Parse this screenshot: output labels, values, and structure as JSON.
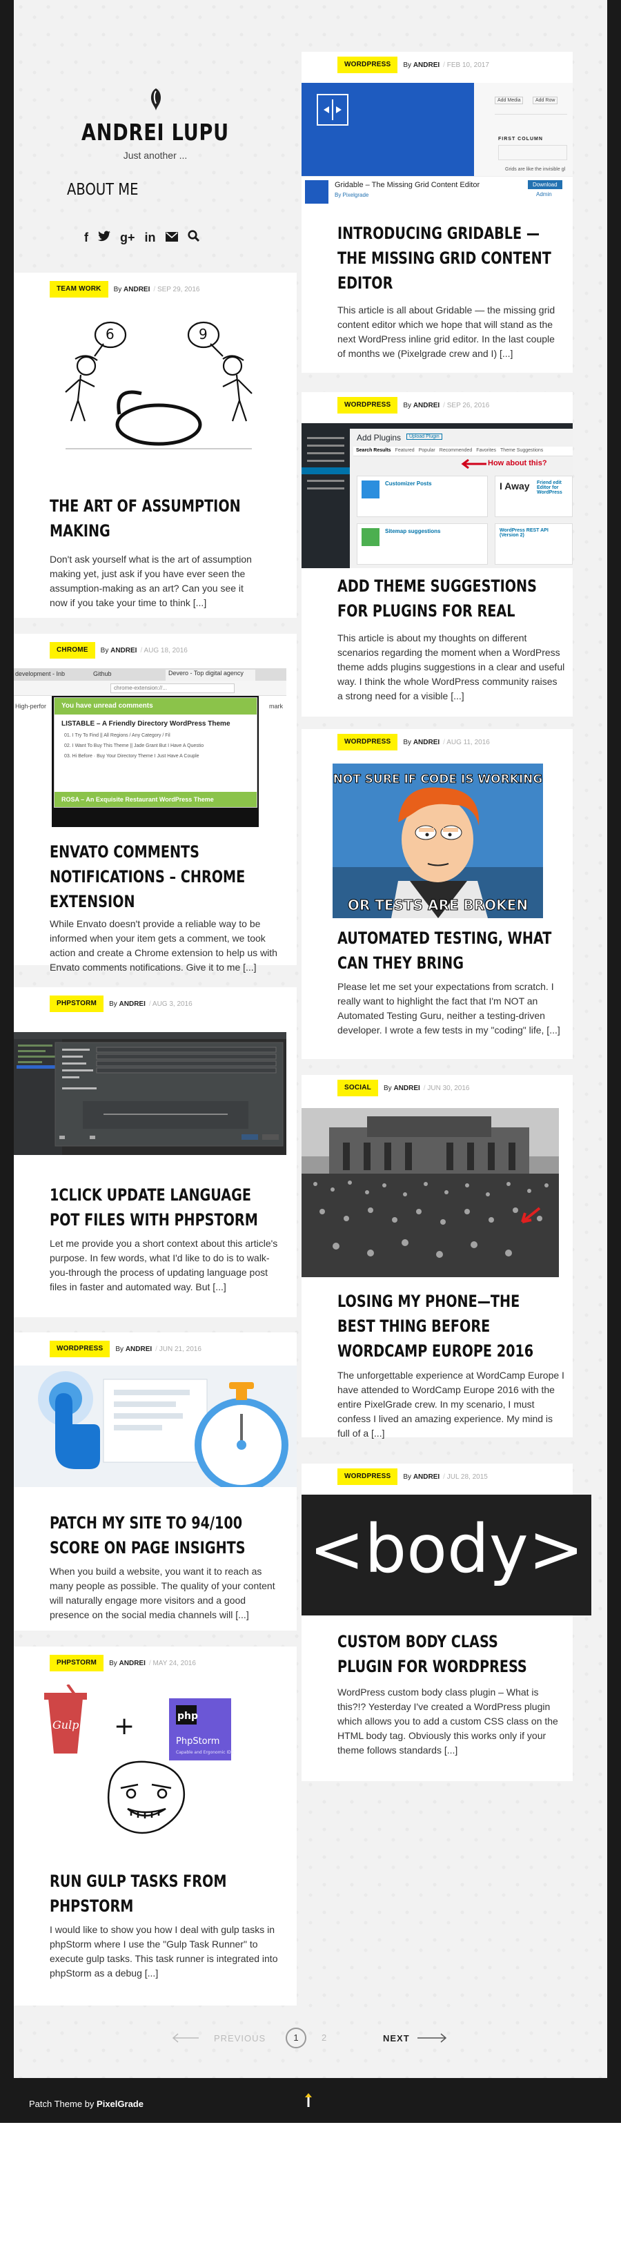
{
  "site": {
    "title": "ANDREI LUPU",
    "tagline": "Just another ...",
    "nav_about": "ABOUT ME",
    "social_icons": [
      "facebook-icon",
      "twitter-icon",
      "google-plus-icon",
      "linkedin-icon",
      "email-icon",
      "search-icon"
    ]
  },
  "colors": {
    "category_badge": "#fff200",
    "page_bg": "#f2f2f2",
    "frame_bg": "#1a1a1a",
    "card_bg": "#ffffff"
  },
  "posts": [
    {
      "category": "TEAM WORK",
      "by": "By",
      "author": "ANDREI",
      "date": "SEP 29, 2016",
      "title": "THE ART OF ASSUMPTION MAKING",
      "excerpt": "Don't ask yourself what is the art of assumption making yet, just ask if you have ever seen the assumption-making as an art? Can you see it now if you take your time to think [...]"
    },
    {
      "category": "CHROME",
      "by": "By",
      "author": "ANDREI",
      "date": "AUG 18, 2016",
      "title": "ENVATO COMMENTS NOTIFICATIONS – CHROME EXTENSION",
      "excerpt": "While Envato doesn't provide a reliable way to be informed when your item gets a comment, we took action and create a Chrome extension to help us with Envato comments notifications. Give it to me [...]",
      "thumb": {
        "tab1": "development - Inb",
        "tab2": "Github",
        "tab3": "Devero - Top digital agency",
        "url_bar": "chrome-extension://...",
        "popup_header": "You have unread comments",
        "popup_item1_title": "LISTABLE – A Friendly Directory WordPress Theme",
        "popup_item1_lines": [
          "01. I Try To Find || All Regions / Any Category / Fil",
          "02. I Want To Buy This Theme || Jade Grant But I Have A Questio",
          "03. Hi Before · Buy Your Directory Theme I Just Have A Couple"
        ],
        "popup_item2_title": "ROSA – An Exquisite Restaurant WordPress Theme",
        "left_text": "High-perfor",
        "right_text": "mark"
      }
    },
    {
      "category": "PHPSTORM",
      "by": "By",
      "author": "ANDREI",
      "date": "AUG 3, 2016",
      "title": "1CLICK UPDATE LANGUAGE POT FILES WITH PHPSTORM",
      "excerpt": "Let me provide you a short context about this article's purpose. In few words, what I'd like to do is to walk-you-through the process of updating language post files in faster and automated way. But [...]"
    },
    {
      "category": "WORDPRESS",
      "by": "By",
      "author": "ANDREI",
      "date": "JUN 21, 2016",
      "title": "PATCH MY SITE TO 94/100 SCORE ON PAGE INSIGHTS",
      "excerpt": "When you build a website, you want it to reach as many people as possible. The quality of your content will naturally engage more visitors and a good presence on the social media channels will [...]"
    },
    {
      "category": "PHPSTORM",
      "by": "By",
      "author": "ANDREI",
      "date": "MAY 24, 2016",
      "title": "RUN GULP TASKS FROM PHPSTORM",
      "excerpt": "I would like to show you how I deal with gulp tasks in phpStorm where I use the \"Gulp Task Runner\" to execute gulp tasks. This task runner is integrated into phpStorm as a debug [...]",
      "thumb": {
        "gulp_label": "Gulp",
        "phpstorm_label": "PhpStorm",
        "phpstorm_sub": "Capable and Ergonomic IDE",
        "plus": "+"
      }
    },
    {
      "category": "WORDPRESS",
      "by": "By",
      "author": "ANDREI",
      "date": "FEB 10, 2017",
      "title": "INTRODUCING GRIDABLE — THE MISSING GRID CONTENT EDITOR",
      "excerpt": "This article is all about Gridable — the missing grid content editor which we hope that will stand as the next WordPress inline grid editor. In the last couple of months we (Pixelgrade crew and I) [...]",
      "thumb": {
        "plugin_name": "Gridable – The Missing Grid Content Editor",
        "plugin_by": "By Pixelgrade",
        "download_btn": "Download",
        "admin_link": "Admin",
        "add_media": "Add Media",
        "add_row": "Add Row",
        "first_column": "FIRST COLUMN",
        "grids_text": "Grids are like the invisible gl"
      }
    },
    {
      "category": "WORDPRESS",
      "by": "By",
      "author": "ANDREI",
      "date": "SEP 26, 2016",
      "title": "ADD THEME SUGGESTIONS FOR PLUGINS FOR REAL",
      "excerpt": "This article is about my thoughts on different scenarios regarding the moment when a WordPress theme adds plugins suggestions in a clear and useful way. I think the whole WordPress community raises a strong need for a visible [...]",
      "thumb": {
        "heading": "Add Plugins",
        "upload_btn": "Upload Plugin",
        "tabs": [
          "Search Results",
          "Featured",
          "Popular",
          "Recommended",
          "Favorites",
          "Theme Suggestions"
        ],
        "callout": "How about this?",
        "plugin1": "Customizer Posts",
        "plugin2": "Friend edit Editor for WordPress",
        "plugin3": "Sitemap suggestions",
        "plugin4": "WordPress REST API (Version 2)"
      }
    },
    {
      "category": "WORDPRESS",
      "by": "By",
      "author": "ANDREI",
      "date": "AUG 11, 2016",
      "title": "AUTOMATED TESTING, WHAT CAN THEY BRING",
      "excerpt": "Please let me set your expectations from scratch. I really want to highlight the fact that I'm NOT an Automated Testing Guru, neither a testing-driven developer. I wrote a few tests in my \"coding\" life, [...]",
      "thumb": {
        "meme_top": "NOT SURE IF CODE IS WORKING",
        "meme_bottom": "OR TESTS ARE BROKEN"
      }
    },
    {
      "category": "SOCIAL",
      "by": "By",
      "author": "ANDREI",
      "date": "JUN 30, 2016",
      "title": "LOSING MY PHONE—THE BEST THING BEFORE WORDCAMP EUROPE 2016",
      "excerpt": "The unforgettable experience at WordCamp Europe I have attended to WordCamp Europe 2016 with the entire PixelGrade crew. In my scenario, I must confess I lived an amazing experience. My mind is full of a [...]"
    },
    {
      "category": "WORDPRESS",
      "by": "By",
      "author": "ANDREI",
      "date": "JUL 28, 2015",
      "title": "CUSTOM BODY CLASS PLUGIN FOR WORDPRESS",
      "excerpt": "WordPress custom body class plugin – What is this?!? Yesterday I've created a WordPress plugin which allows you to add a custom CSS class on the HTML body tag. Obviously this works only if your theme follows standards [...]",
      "thumb": {
        "code": "<body>"
      }
    }
  ],
  "pagination": {
    "previous": "PREVIOUS",
    "current": "1",
    "page2": "2",
    "next": "NEXT"
  },
  "footer": {
    "text": "Patch Theme by",
    "brand": "PixelGrade"
  }
}
